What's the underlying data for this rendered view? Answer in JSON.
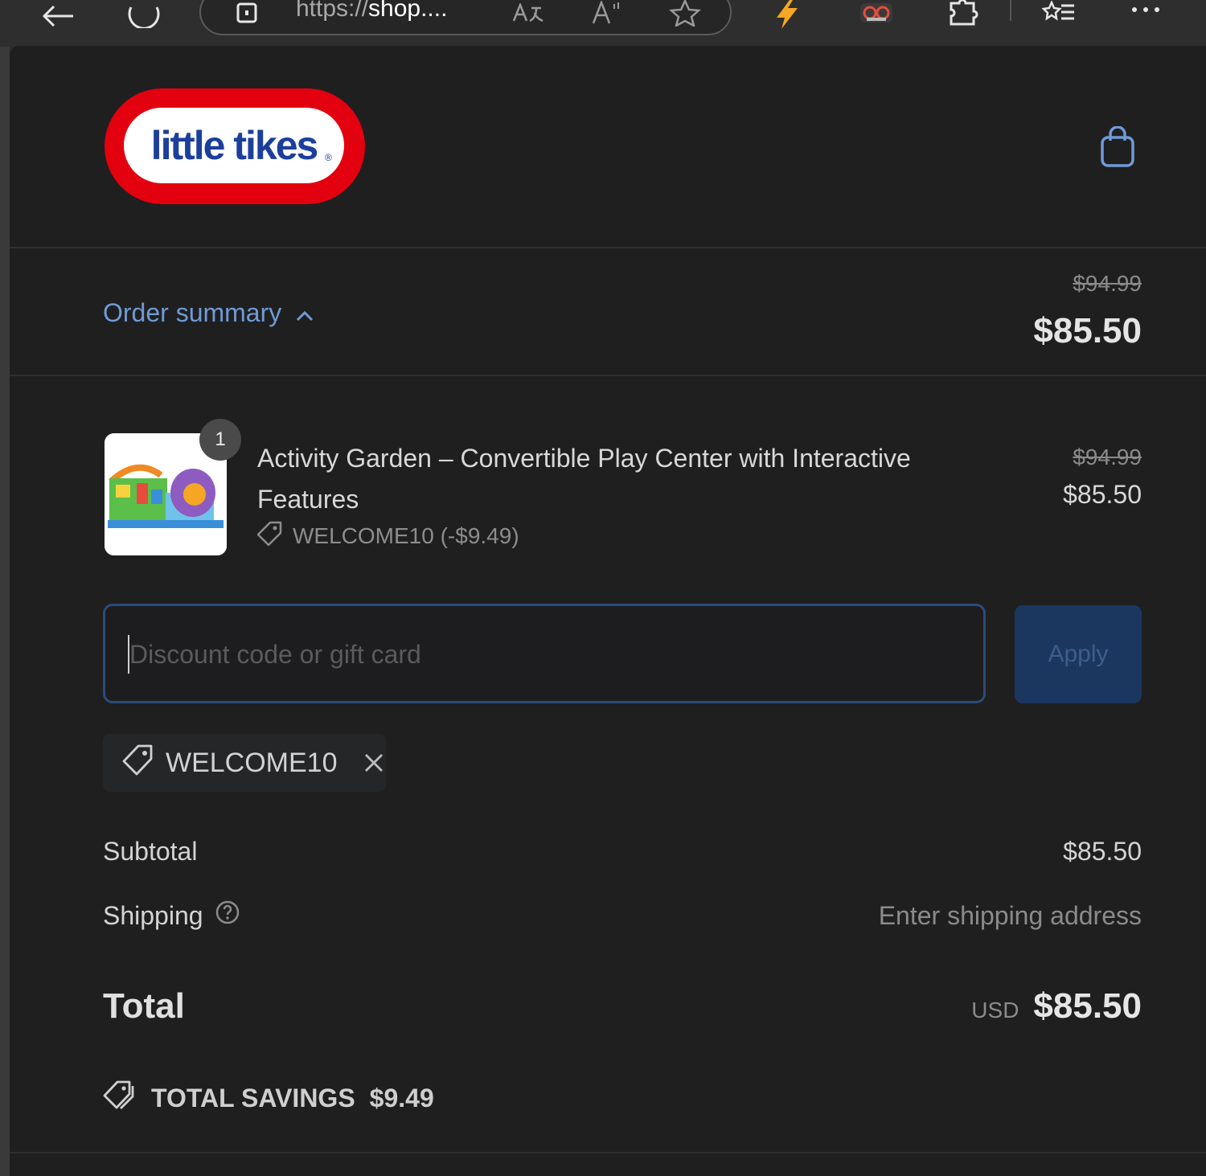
{
  "browser": {
    "url_scheme": "https://",
    "url_host": "shop....",
    "icons": [
      "back-icon",
      "refresh-icon",
      "site-info-icon",
      "translate-icon",
      "read-aloud-icon",
      "favorite-star-icon",
      "extension-bolt-icon",
      "extension-glasses-icon",
      "extensions-puzzle-icon",
      "favorites-list-icon",
      "more-icon"
    ]
  },
  "header": {
    "logo_text": "little tikes",
    "logo_colors": {
      "ring": "#e3000f",
      "text": "#1c3f9c",
      "fill": "#ffffff"
    },
    "cart_icon": "shopping-bag-icon"
  },
  "summary": {
    "toggle_label": "Order summary",
    "original_price": "$94.99",
    "price": "$85.50"
  },
  "item": {
    "quantity": "1",
    "title": "Activity Garden – Convertible Play Center with Interactive Features",
    "discount_label": "WELCOME10 (-$9.49)",
    "original_price": "$94.99",
    "price": "$85.50"
  },
  "discount": {
    "placeholder": "Discount code or gift card",
    "value": "",
    "apply_label": "Apply"
  },
  "applied_code": {
    "code": "WELCOME10"
  },
  "totals": {
    "subtotal_label": "Subtotal",
    "subtotal_value": "$85.50",
    "shipping_label": "Shipping",
    "shipping_value": "Enter shipping address",
    "total_label": "Total",
    "currency": "USD",
    "total_value": "$85.50",
    "savings_label": "TOTAL SAVINGS",
    "savings_value": "$9.49"
  },
  "colors": {
    "accent_link": "#6f9bd6",
    "apply_button": "#1b3760",
    "input_border": "#2c4a7a",
    "page_bg": "#1f1f20"
  }
}
